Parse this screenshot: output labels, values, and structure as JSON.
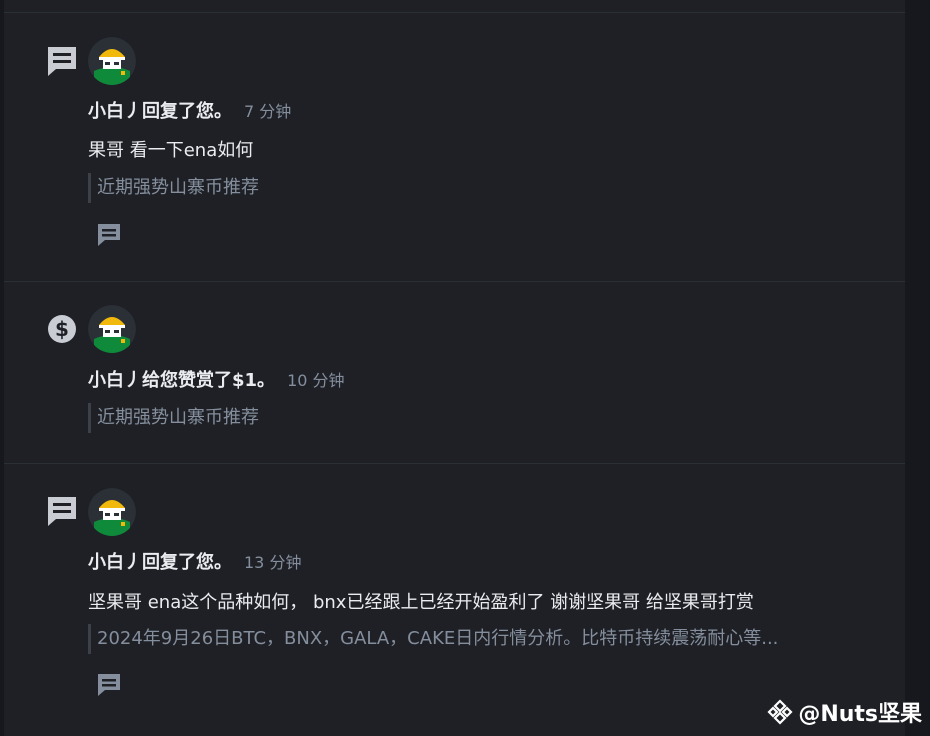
{
  "notifications": [
    {
      "type_icon": "comment-icon",
      "user": "小白丿",
      "action": "回复了您。",
      "time": "7 分钟",
      "content": "果哥 看一下ena如何",
      "quote": "近期强势山寨币推荐"
    },
    {
      "type_icon": "dollar-icon",
      "user": "小白丿",
      "action": "给您赞赏了$1。",
      "time": "10 分钟",
      "quote": "近期强势山寨币推荐"
    },
    {
      "type_icon": "comment-icon",
      "user": "小白丿",
      "action": "回复了您。",
      "time": "13 分钟",
      "content": "坚果哥 ena这个品种如何， bnx已经跟上已经开始盈利了 谢谢坚果哥 给坚果哥打赏",
      "quote": "2024年9月26日BTC，BNX，GALA，CAKE日内行情分析。比特币持续震荡耐心等..."
    }
  ],
  "watermark": "@Nuts坚果",
  "colors": {
    "background": "#1e2026",
    "text_primary": "#eaecef",
    "text_secondary": "#848e9c",
    "avatar_yellow": "#f0b90b",
    "avatar_green": "#0e8a3a"
  }
}
